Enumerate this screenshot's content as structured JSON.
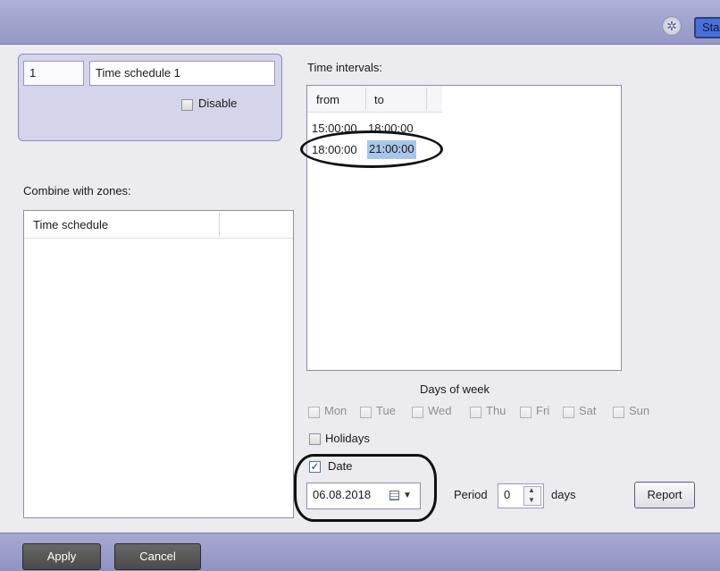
{
  "toolbar": {
    "start_label": "Sta",
    "gear_icon": "gear-icon"
  },
  "schedule": {
    "id": "1",
    "name": "Time schedule 1",
    "disable_label": "Disable",
    "disabled": false
  },
  "zones": {
    "label": "Combine with zones:",
    "columns": [
      "Time schedule"
    ],
    "rows": []
  },
  "intervals": {
    "label": "Time intervals:",
    "columns": [
      "from",
      "to"
    ],
    "rows": [
      {
        "from": "15:00:00",
        "to": "18:00:00"
      },
      {
        "from": "18:00:00",
        "to": "21:00:00",
        "selected": true
      }
    ]
  },
  "days": {
    "label": "Days of week",
    "items": [
      "Mon",
      "Tue",
      "Wed",
      "Thu",
      "Fri",
      "Sat",
      "Sun"
    ],
    "holidays_label": "Holidays"
  },
  "date": {
    "label": "Date",
    "checked": true,
    "value": "06.08.2018"
  },
  "period": {
    "label": "Period",
    "value": "0",
    "unit": "days"
  },
  "buttons": {
    "report": "Report",
    "apply": "Apply",
    "cancel": "Cancel"
  },
  "colors": {
    "selection": "#a9c6ea",
    "panel": "#d4d4ea",
    "bar": "#9d9fcc"
  }
}
